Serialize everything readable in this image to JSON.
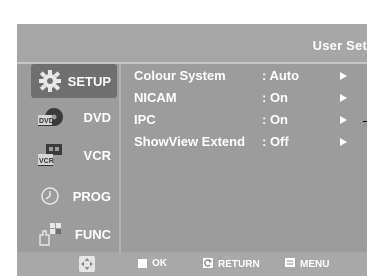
{
  "header": {
    "title": "User Set"
  },
  "sidebar": {
    "items": [
      {
        "label": "SETUP",
        "icon": "gear-icon",
        "active": true
      },
      {
        "label": "DVD",
        "icon": "dvd-icon",
        "icon_text": "DVD",
        "active": false
      },
      {
        "label": "VCR",
        "icon": "vcr-icon",
        "icon_text": "VCR",
        "active": false
      },
      {
        "label": "PROG",
        "icon": "clock-icon",
        "active": false
      },
      {
        "label": "FUNC",
        "icon": "function-icon",
        "active": false
      }
    ]
  },
  "menu": {
    "rows": [
      {
        "label": "Colour  System",
        "value": ": Auto"
      },
      {
        "label": "NICAM",
        "value": ": On"
      },
      {
        "label": "IPC",
        "value": ": On"
      },
      {
        "label": "ShowView Extend",
        "value": ": Off"
      }
    ]
  },
  "footer": {
    "ok_label": "OK",
    "return_label": "RETURN",
    "menu_label": "MENU"
  },
  "colors": {
    "background": "#9c9c9c",
    "active_item": "#6f6f6f",
    "text": "#ffffff"
  }
}
